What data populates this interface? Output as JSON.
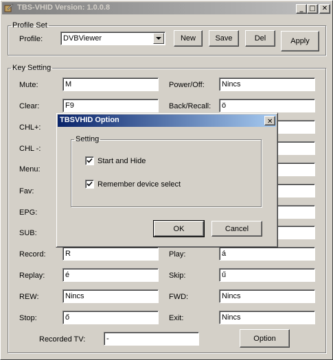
{
  "window": {
    "title": "TBS-VHID Version: 1.0.0.8",
    "caption_buttons": [
      "minimize-icon",
      "maximize-icon",
      "close-icon"
    ]
  },
  "profile_set": {
    "legend": "Profile Set",
    "profile_label": "Profile:",
    "profile_value": "DVBViewer",
    "new_label": "New",
    "save_label": "Save",
    "del_label": "Del",
    "apply_label": "Apply"
  },
  "key_setting": {
    "legend": "Key Setting",
    "left": [
      {
        "label": "Mute:",
        "value": "M"
      },
      {
        "label": "Clear:",
        "value": "F9"
      },
      {
        "label": "CHL+:",
        "value": ""
      },
      {
        "label": "CHL -:",
        "value": ""
      },
      {
        "label": "Menu:",
        "value": ""
      },
      {
        "label": "Fav:",
        "value": ""
      },
      {
        "label": "EPG:",
        "value": ""
      },
      {
        "label": "SUB:",
        "value": ""
      },
      {
        "label": "Record:",
        "value": "R"
      },
      {
        "label": "Replay:",
        "value": "é"
      },
      {
        "label": "REW:",
        "value": "Nincs"
      },
      {
        "label": "Stop:",
        "value": "ő"
      }
    ],
    "right": [
      {
        "label": "Power/Off:",
        "value": "Nincs"
      },
      {
        "label": "Back/Recall:",
        "value": "ö"
      },
      {
        "label": "",
        "value": ""
      },
      {
        "label": "",
        "value": ""
      },
      {
        "label": "",
        "value": ""
      },
      {
        "label": "",
        "value": ""
      },
      {
        "label": "",
        "value": ""
      },
      {
        "label": "",
        "value": ""
      },
      {
        "label": "Play:",
        "value": "á"
      },
      {
        "label": "Skip:",
        "value": "ű"
      },
      {
        "label": "FWD:",
        "value": "Nincs"
      },
      {
        "label": "Exit:",
        "value": "Nincs"
      }
    ],
    "recorded_tv_label": "Recorded TV:",
    "recorded_tv_value": "-",
    "option_label": "Option"
  },
  "dialog": {
    "title": "TBSVHID Option",
    "setting_legend": "Setting",
    "start_and_hide_label": "Start and Hide",
    "start_and_hide_checked": true,
    "remember_label": "Remember device select",
    "remember_checked": true,
    "ok_label": "OK",
    "cancel_label": "Cancel"
  },
  "colors": {
    "face": "#d4d0c8",
    "active_title": "#0a246a",
    "inactive_title": "#808080"
  }
}
